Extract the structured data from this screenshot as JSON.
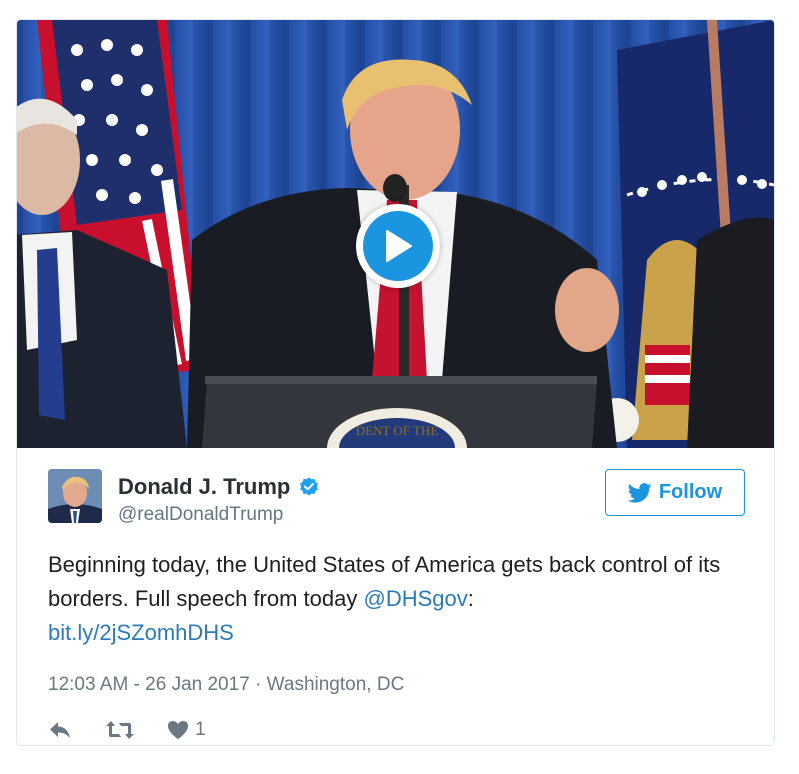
{
  "media": {
    "type": "video",
    "play_icon": "play-icon",
    "seal_text": "DENT OF THE"
  },
  "author": {
    "display_name": "Donald J. Trump",
    "handle": "@realDonaldTrump",
    "verified": true,
    "verified_icon": "verified-badge-icon",
    "avatar_icon": "avatar"
  },
  "follow": {
    "label": "Follow",
    "icon": "twitter-bird-icon"
  },
  "tweet": {
    "text_before": "Beginning today, the United States of America gets back control of its borders. Full speech from today ",
    "mention": "@DHSgov",
    "text_after": ": ",
    "link": "bit.ly/2jSZomhDHS"
  },
  "meta": {
    "timestamp": "12:03 AM - 26 Jan 2017",
    "separator": " · ",
    "location": "Washington, DC"
  },
  "actions": {
    "reply_icon": "reply-icon",
    "retweet_icon": "retweet-icon",
    "like_icon": "heart-icon",
    "like_count": "1"
  },
  "colors": {
    "link": "#2b7bb9",
    "accent": "#1b95e0",
    "text": "#1c2022",
    "muted": "#697882",
    "border": "#e1e8ed"
  }
}
